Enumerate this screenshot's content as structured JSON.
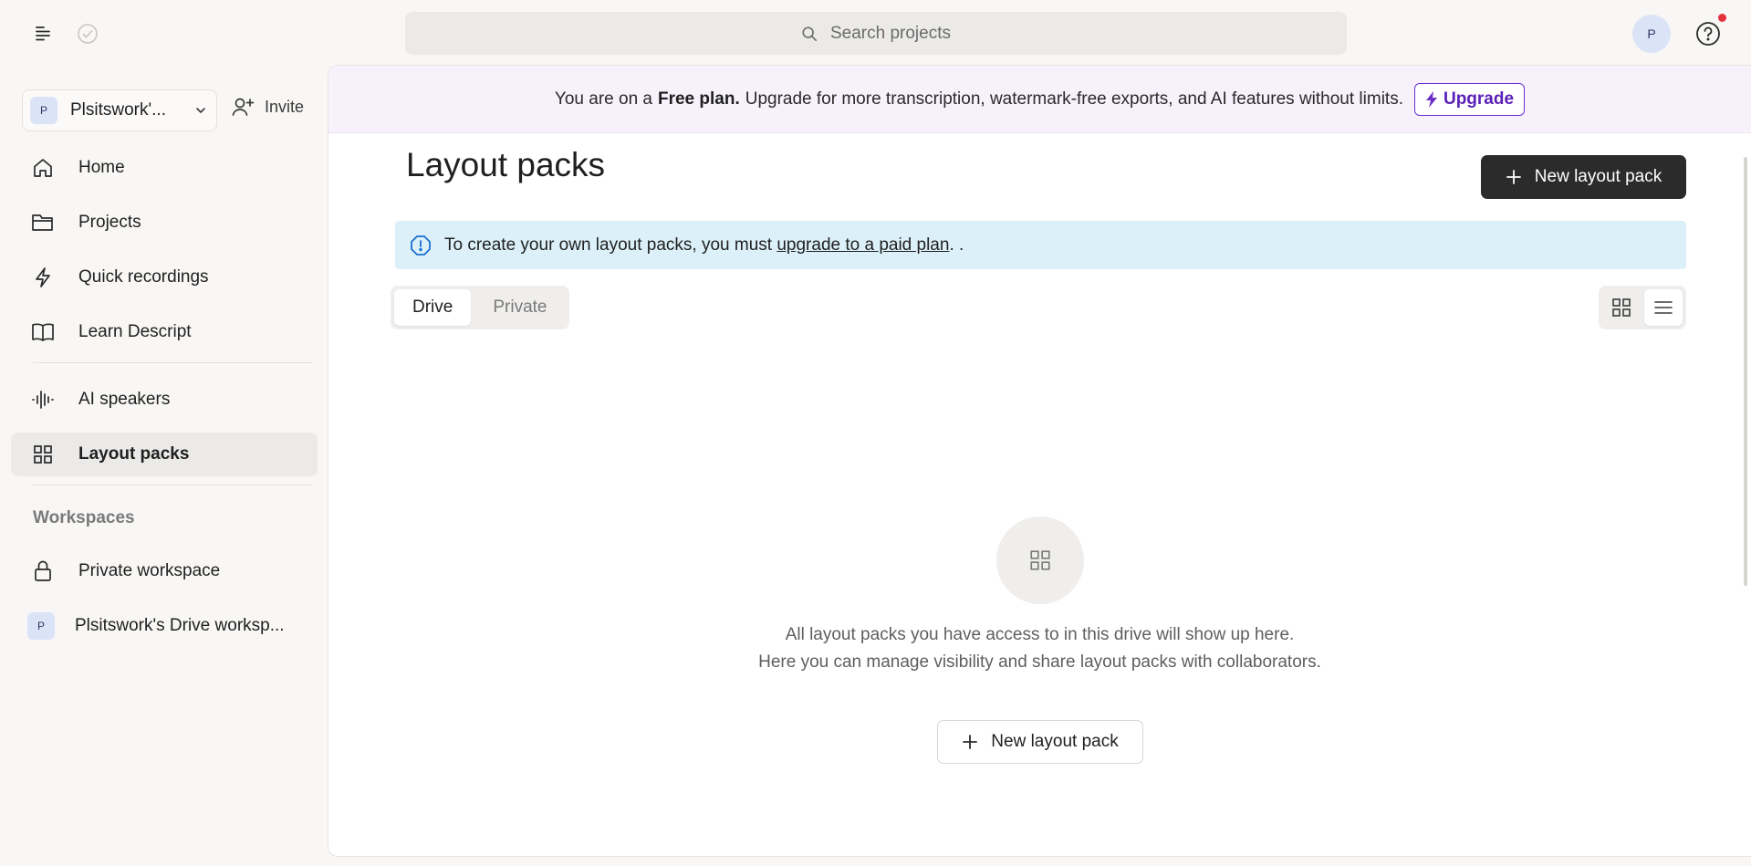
{
  "topbar": {
    "search_placeholder": "Search projects",
    "avatar_initial": "P"
  },
  "sidebar": {
    "workspace": {
      "badge": "P",
      "name": "Plsitswork'..."
    },
    "invite_label": "Invite",
    "items": [
      {
        "label": "Home",
        "icon": "home-icon"
      },
      {
        "label": "Projects",
        "icon": "folder-icon"
      },
      {
        "label": "Quick recordings",
        "icon": "lightning-icon"
      },
      {
        "label": "Learn Descript",
        "icon": "book-icon"
      },
      {
        "label": "AI speakers",
        "icon": "waveform-icon"
      },
      {
        "label": "Layout packs",
        "icon": "grid-icon",
        "active": true
      }
    ],
    "workspaces_label": "Workspaces",
    "workspaces": [
      {
        "label": "Private workspace",
        "icon": "lock-icon"
      },
      {
        "label": "Plsitswork's Drive worksp...",
        "badge": "P"
      }
    ]
  },
  "banner": {
    "prefix": "You are on a",
    "plan": "Free plan.",
    "message": "Upgrade for more transcription, watermark-free exports, and AI features without limits.",
    "upgrade_label": "Upgrade"
  },
  "main": {
    "title": "Layout packs",
    "new_button_label": "New layout pack",
    "info_prefix": "To create your own layout packs, you must",
    "info_link": "upgrade to a paid plan",
    "info_suffix": ". .",
    "tabs": [
      "Drive",
      "Private"
    ],
    "empty_line1": "All layout packs you have access to in this drive will show up here.",
    "empty_line2": "Here you can manage visibility and share layout packs with collaborators.",
    "empty_button_label": "New layout pack"
  },
  "colors": {
    "accent_purple": "#6a2fc9",
    "info_bg": "#dcf0f9",
    "banner_bg": "#f6f1fb",
    "dark_button": "#2b2b2b",
    "notification_dot": "#e5333b"
  }
}
